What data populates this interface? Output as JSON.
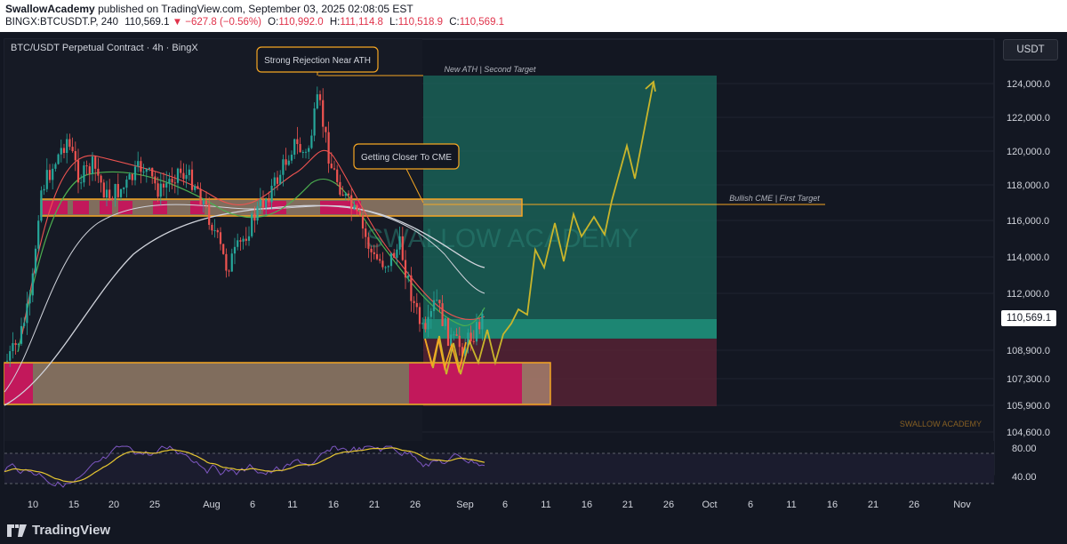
{
  "header": {
    "author": "SwallowAcademy",
    "published_text": "published on TradingView.com, September 03, 2025 02:08:05 EST",
    "symbol": "BINGX:BTCUSDT.P, 240",
    "last": "110,569.1",
    "change": "−627.8 (−0.56%)",
    "o_label": "O:",
    "o": "110,992.0",
    "h_label": "H:",
    "h": "111,114.8",
    "l_label": "L:",
    "l": "110,518.9",
    "c_label": "C:",
    "c": "110,569.1"
  },
  "chart": {
    "title": "BTC/USDT Perpetual Contract · 4h · BingX",
    "currency_button": "USDT",
    "current_price": "110,569.1",
    "watermark": "SWALLOW ACADEMY",
    "watermark_small": "SWALLOW ACADEMY",
    "annotations": {
      "rejection": "Strong Rejection Near ATH",
      "cme": "Getting Closer To CME",
      "second_target": "New ATH | Second Target",
      "first_target": "Bullish CME | First Target"
    },
    "price_axis": [
      "124,000.0",
      "122,000.0",
      "120,000.0",
      "118,000.0",
      "116,000.0",
      "114,000.0",
      "112,000.0",
      "108,900.0",
      "107,300.0",
      "105,900.0",
      "104,600.0"
    ],
    "rsi_axis": [
      "80.00",
      "40.00"
    ],
    "time_axis": [
      "10",
      "15",
      "20",
      "25",
      "Aug",
      "6",
      "11",
      "16",
      "21",
      "26",
      "Sep",
      "6",
      "11",
      "16",
      "21",
      "26",
      "Oct",
      "6",
      "11",
      "16",
      "21",
      "26",
      "Nov"
    ],
    "colors": {
      "background": "#131722",
      "bull": "#26a69a",
      "bear": "#ef5350",
      "zone_fill": "#d9b38c",
      "zone_border": "#f5a623",
      "magenta": "#c2185b",
      "target_box": "#1b6b5e",
      "stop_box": "#5a2336",
      "projection": "#c9b52b",
      "rsi_line": "#7e57c2"
    }
  },
  "footer": {
    "brand": "TradingView"
  }
}
